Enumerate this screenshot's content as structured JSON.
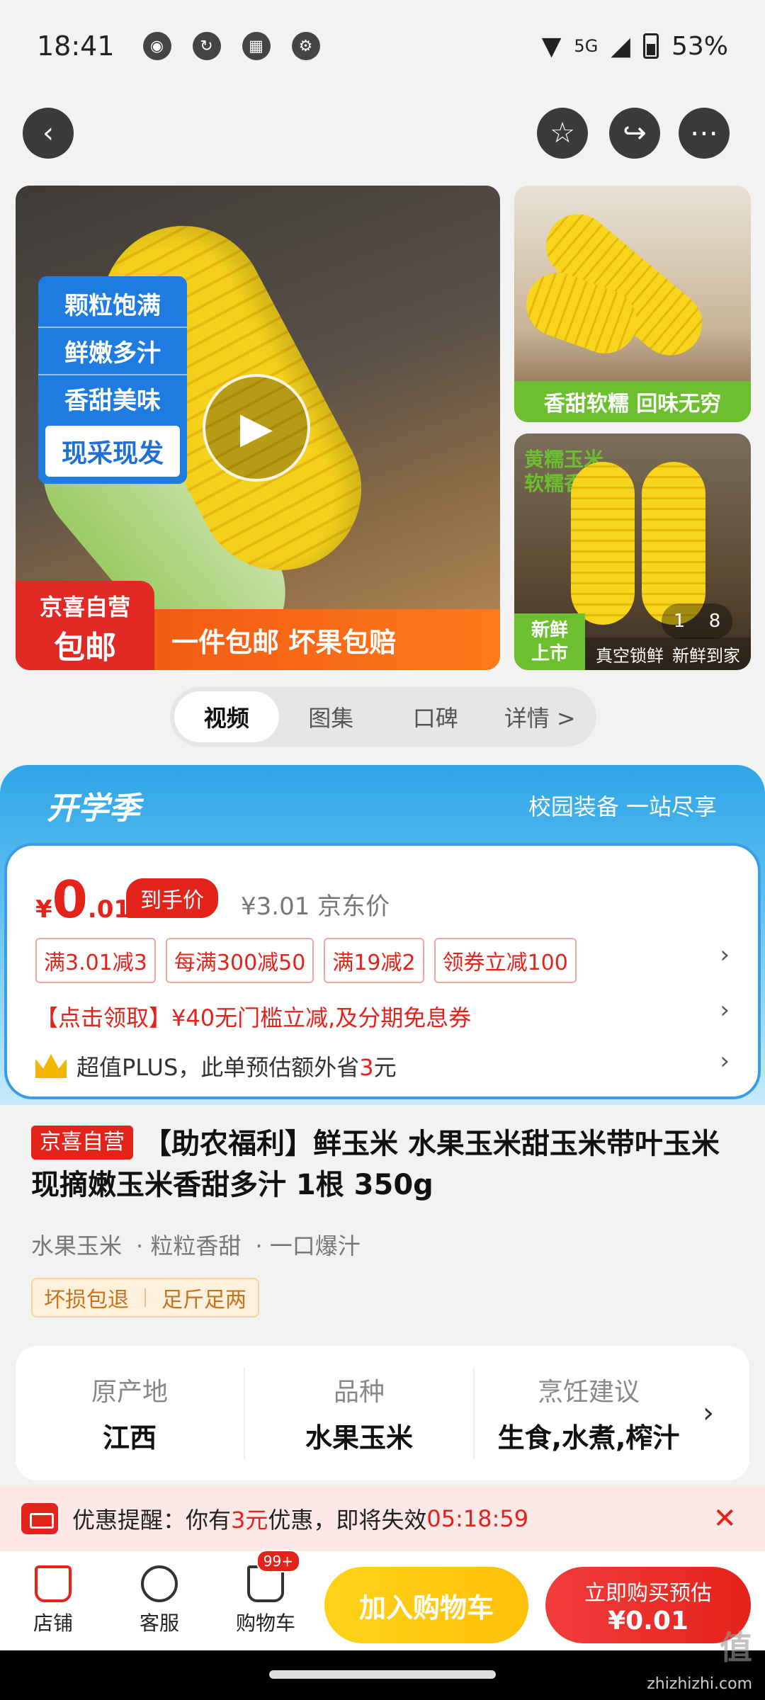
{
  "status_bar": {
    "time": "18:41",
    "network": "5G",
    "battery": "53%"
  },
  "gallery": {
    "features": [
      "颗粒饱满",
      "鲜嫩多汁",
      "香甜美味"
    ],
    "highlight": "现采现发",
    "self_operated_line1": "京喜自营",
    "self_operated_line2": "包邮",
    "promo_banner": "一件包邮 坏果包赔",
    "thumb1_caption": "香甜软糯 回味无穷",
    "thumb2_tag_line1": "黄糯玉米",
    "thumb2_tag_line2": "软糯香黏",
    "thumb2_new_line1": "新鲜",
    "thumb2_new_line2": "上市",
    "thumb2_caption_a": "真空锁鲜",
    "thumb2_caption_b": "新鲜到家",
    "page_current": "1",
    "page_total": "8"
  },
  "media_tabs": [
    "视频",
    "图集",
    "口碑",
    "详情 >"
  ],
  "season": {
    "title": "开学季",
    "subtitle": "校园装备 一站尽享"
  },
  "price": {
    "symbol": "¥",
    "integer": "0",
    "decimal": ".01",
    "badge": "到手价",
    "reference": "¥3.01 京东价",
    "coupons": [
      "满3.01减3",
      "每满300减50",
      "满19减2",
      "领券立减100"
    ],
    "voucher": "【点击领取】¥40无门槛立减,及分期免息券",
    "plus_prefix": "超值PLUS，此单预估额外省",
    "plus_amount": "3",
    "plus_suffix": "元"
  },
  "product": {
    "badge": "京喜自营",
    "title": "【助农福利】鲜玉米 水果玉米甜玉米带叶玉米现摘嫩玉米香甜多汁 1根 350g",
    "features": [
      "水果玉米",
      "粒粒香甜",
      "一口爆汁"
    ],
    "tags": [
      "坏损包退",
      "足斤足两"
    ]
  },
  "specs": [
    {
      "label": "原产地",
      "value": "江西"
    },
    {
      "label": "品种",
      "value": "水果玉米"
    },
    {
      "label": "烹饪建议",
      "value": "生食,水煮,榨汁"
    }
  ],
  "reminder": {
    "prefix": "优惠提醒：你有",
    "amount": "3元",
    "middle": "优惠，即将失效",
    "countdown": "05:18:59"
  },
  "bottom_bar": {
    "store": "店铺",
    "service": "客服",
    "cart": "购物车",
    "cart_badge": "99+",
    "add_cart": "加入购物车",
    "buy_line1": "立即购买预估",
    "buy_line2": "¥0.01"
  },
  "watermark": {
    "logo": "值",
    "site": "zhizhizhi.com"
  },
  "colors": {
    "brand_red": "#e4231b",
    "banner_blue": "#2fa5e8",
    "cart_yellow": "#ffc107"
  }
}
